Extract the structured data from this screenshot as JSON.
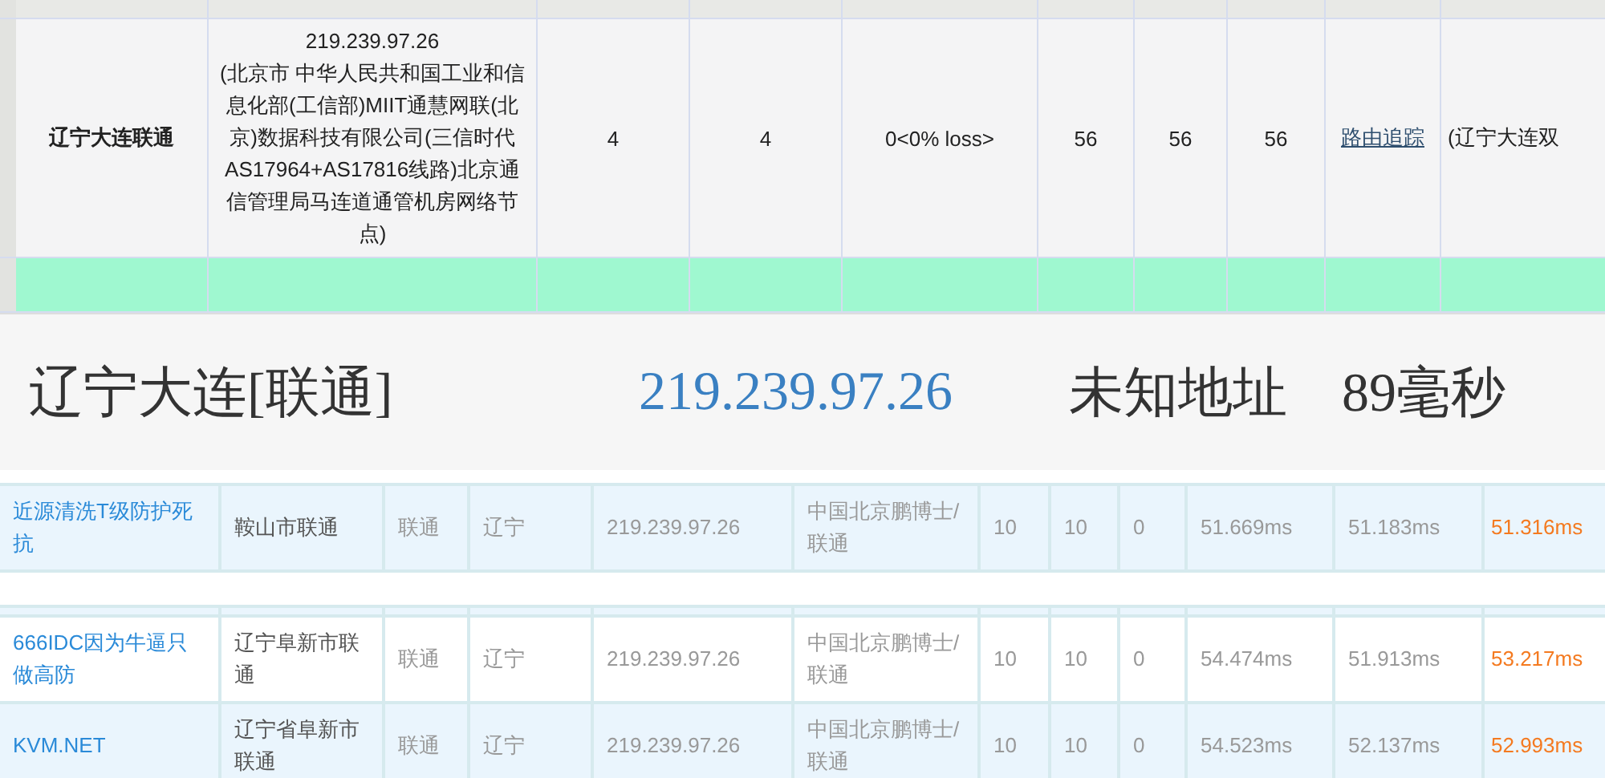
{
  "trace_table": {
    "row": {
      "node": "辽宁大连联通",
      "ip": "219.239.97.26",
      "ip_location": "(北京市 中华人民共和国工业和信息化部(工信部)MIIT通慧网联(北京)数据科技有限公司(三信时代AS17964+AS17816线路)北京通信管理局马连道通管机房网络节点)",
      "cells": [
        {
          "kind": "text",
          "text": "4"
        },
        {
          "kind": "text",
          "text": "4"
        },
        {
          "kind": "text",
          "text": "0<0% loss>"
        },
        {
          "kind": "text",
          "text": "56"
        },
        {
          "kind": "text",
          "text": "56"
        },
        {
          "kind": "text",
          "text": "56"
        },
        {
          "kind": "link",
          "text": "路由追踪"
        },
        {
          "kind": "text",
          "text": "(辽宁大连双"
        }
      ]
    }
  },
  "result_banner": {
    "place": "辽宁大连[联通]",
    "ip": "219.239.97.26",
    "location": "未知地址",
    "latency": "89毫秒"
  },
  "ping_table_top": {
    "rows": [
      {
        "node": "近源清洗T级防护死抗",
        "city": "鞍山市联通",
        "isp": "联通",
        "province": "辽宁",
        "ip": "219.239.97.26",
        "ip_location": "中国北京鹏博士/联通",
        "sent": "10",
        "received": "10",
        "lost": "0",
        "max": "51.669ms",
        "min": "51.183ms",
        "avg": "51.316ms"
      }
    ]
  },
  "ping_table_bottom": {
    "rows": [
      {
        "node": "666IDC因为牛逼只做高防",
        "city": "辽宁阜新市联通",
        "isp": "联通",
        "province": "辽宁",
        "ip": "219.239.97.26",
        "ip_location": "中国北京鹏博士/联通",
        "sent": "10",
        "received": "10",
        "lost": "0",
        "max": "54.474ms",
        "min": "51.913ms",
        "avg": "53.217ms"
      },
      {
        "node": "KVM.NET",
        "city": "辽宁省阜新市联通",
        "isp": "联通",
        "province": "辽宁",
        "ip": "219.239.97.26",
        "ip_location": "中国北京鹏博士/联通",
        "sent": "10",
        "received": "10",
        "lost": "0",
        "max": "54.523ms",
        "min": "52.137ms",
        "avg": "52.993ms"
      }
    ]
  }
}
